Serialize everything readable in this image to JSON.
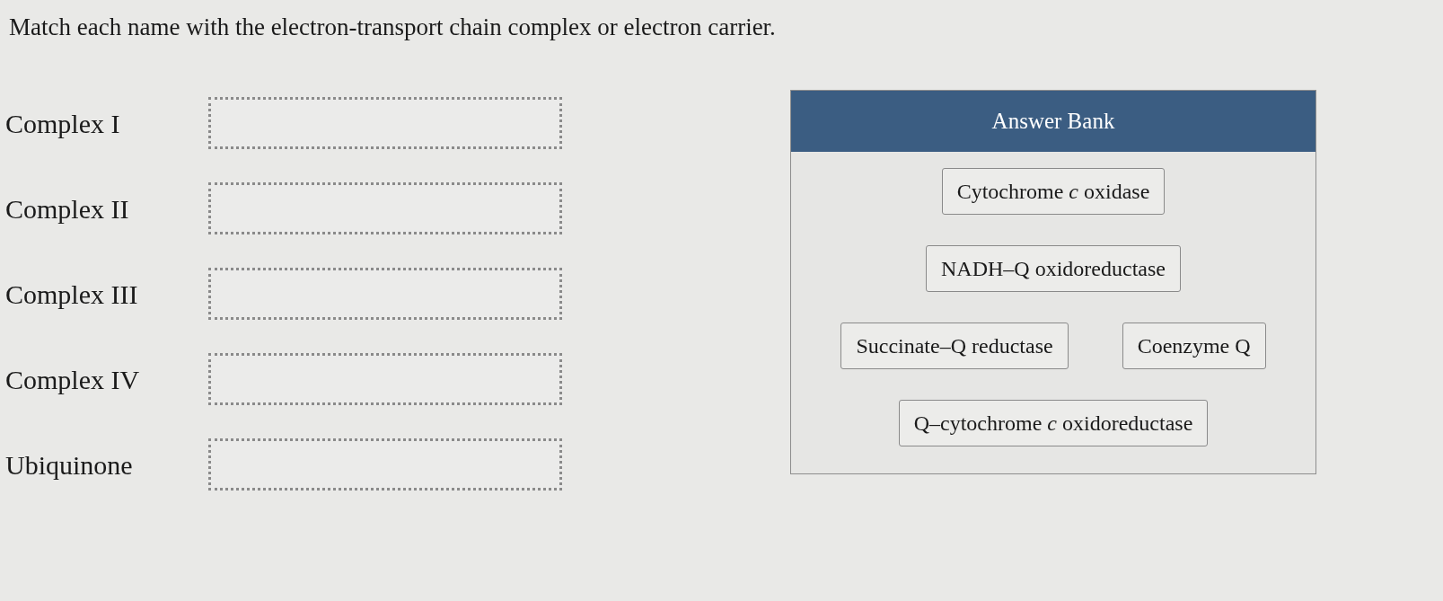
{
  "prompt": "Match each name with the electron-transport chain complex or electron carrier.",
  "targets": [
    {
      "label": "Complex I"
    },
    {
      "label": "Complex II"
    },
    {
      "label": "Complex III"
    },
    {
      "label": "Complex IV"
    },
    {
      "label": "Ubiquinone"
    }
  ],
  "answer_bank": {
    "title": "Answer Bank",
    "rows": [
      [
        "Cytochrome *c* oxidase"
      ],
      [
        "NADH–Q oxidoreductase"
      ],
      [
        "Succinate–Q reductase",
        "Coenzyme Q"
      ],
      [
        "Q–cytochrome *c* oxidoreductase"
      ]
    ]
  }
}
